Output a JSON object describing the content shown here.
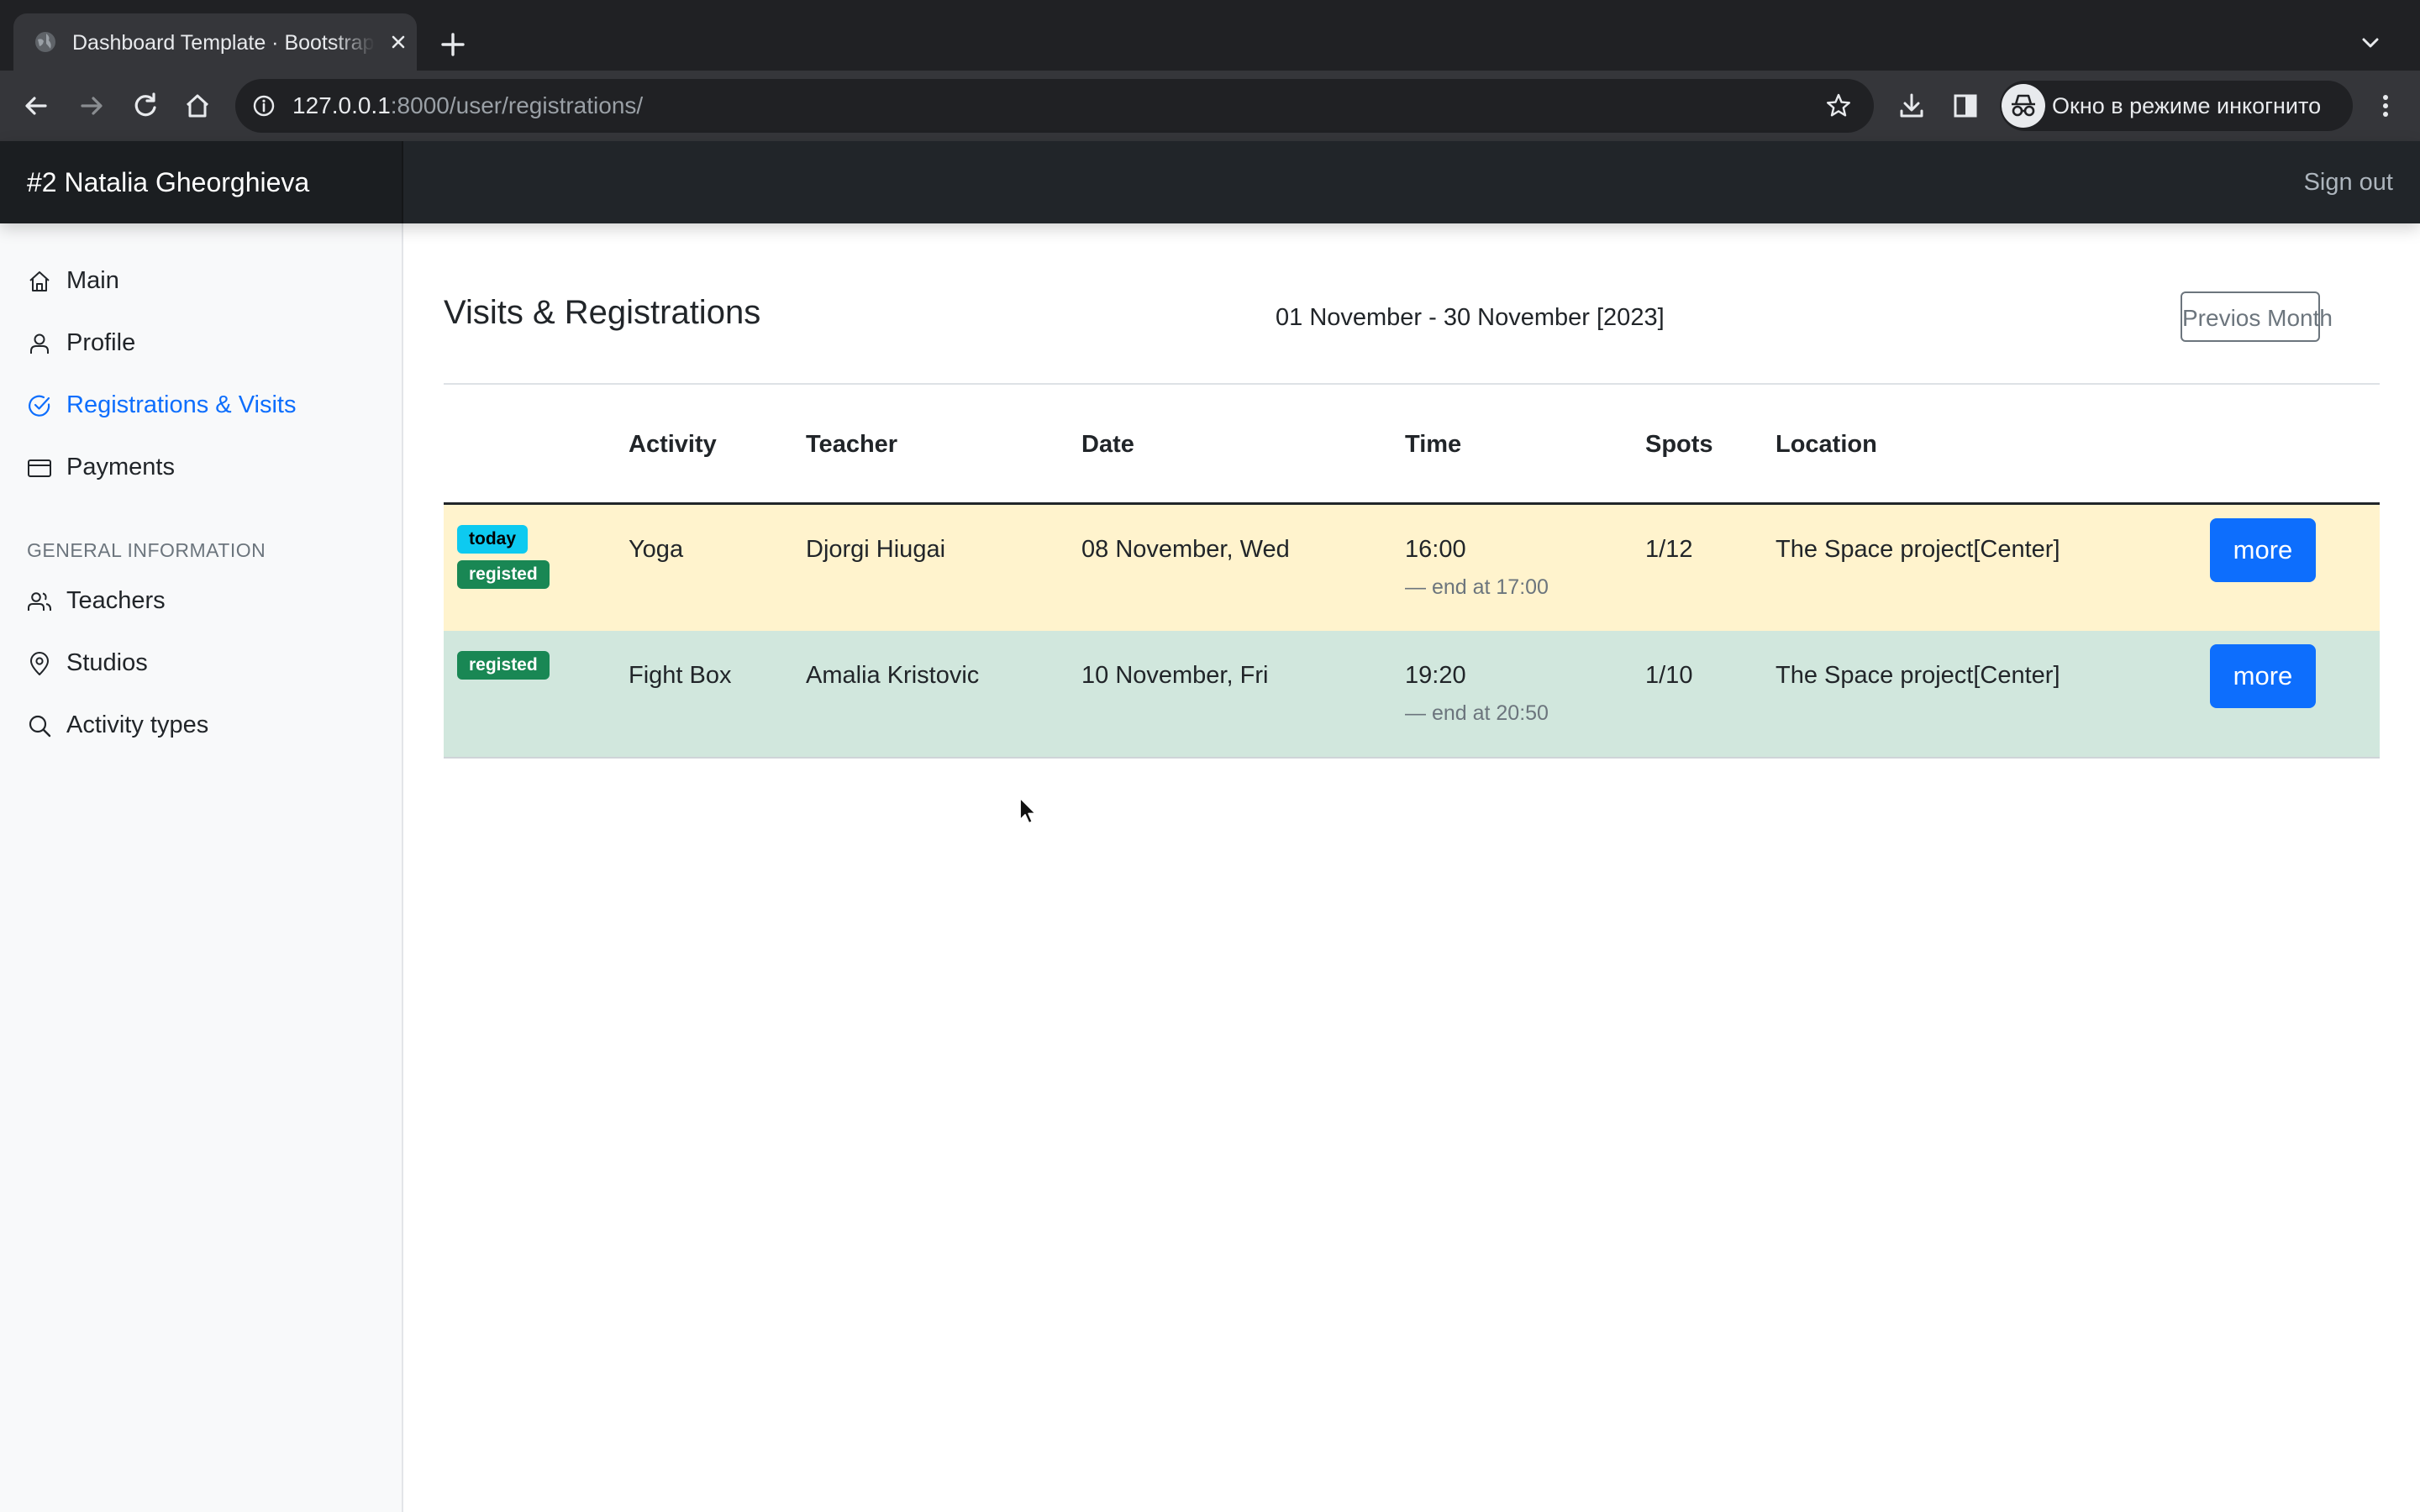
{
  "browser": {
    "tab_title": "Dashboard Template · Bootstrap",
    "url_host": "127.0.0.1",
    "url_rest": ":8000/user/registrations/",
    "incognito_label": "Окно в режиме инкогнито"
  },
  "navbar": {
    "brand": "#2 Natalia Gheorghieva",
    "sign_out": "Sign out"
  },
  "sidebar": {
    "items": [
      {
        "label": "Main",
        "icon": "home-icon"
      },
      {
        "label": "Profile",
        "icon": "user-icon"
      },
      {
        "label": "Registrations & Visits",
        "icon": "check-circle-icon",
        "active": true
      },
      {
        "label": "Payments",
        "icon": "credit-card-icon"
      }
    ],
    "section_heading": "GENERAL INFORMATION",
    "section_items": [
      {
        "label": "Teachers",
        "icon": "users-icon"
      },
      {
        "label": "Studios",
        "icon": "map-pin-icon"
      },
      {
        "label": "Activity types",
        "icon": "search-icon"
      }
    ]
  },
  "main": {
    "title": "Visits & Registrations",
    "period": "01 November - 30 November [2023]",
    "prev_button": "Previos Month",
    "table": {
      "headers": [
        "Activity",
        "Teacher",
        "Date",
        "Time",
        "Spots",
        "Location"
      ],
      "rows": [
        {
          "badges": [
            "today",
            "registed"
          ],
          "activity": "Yoga",
          "teacher": "Djorgi Hiugai",
          "date": "08 November, Wed",
          "time": "16:00",
          "end": "— end at 17:00",
          "spots": "1/12",
          "location": "The Space project[Center]",
          "action": "more"
        },
        {
          "badges": [
            "registed"
          ],
          "activity": "Fight Box",
          "teacher": "Amalia Kristovic",
          "date": "10 November, Fri",
          "time": "19:20",
          "end": "— end at 20:50",
          "spots": "1/10",
          "location": "The Space project[Center]",
          "action": "more"
        }
      ]
    }
  },
  "colors": {
    "today_row": "#fff3cd",
    "registered_row": "#d1e7dd",
    "primary": "#0d6efd",
    "badge_today": "#0dcaf0",
    "badge_registered": "#198754"
  }
}
